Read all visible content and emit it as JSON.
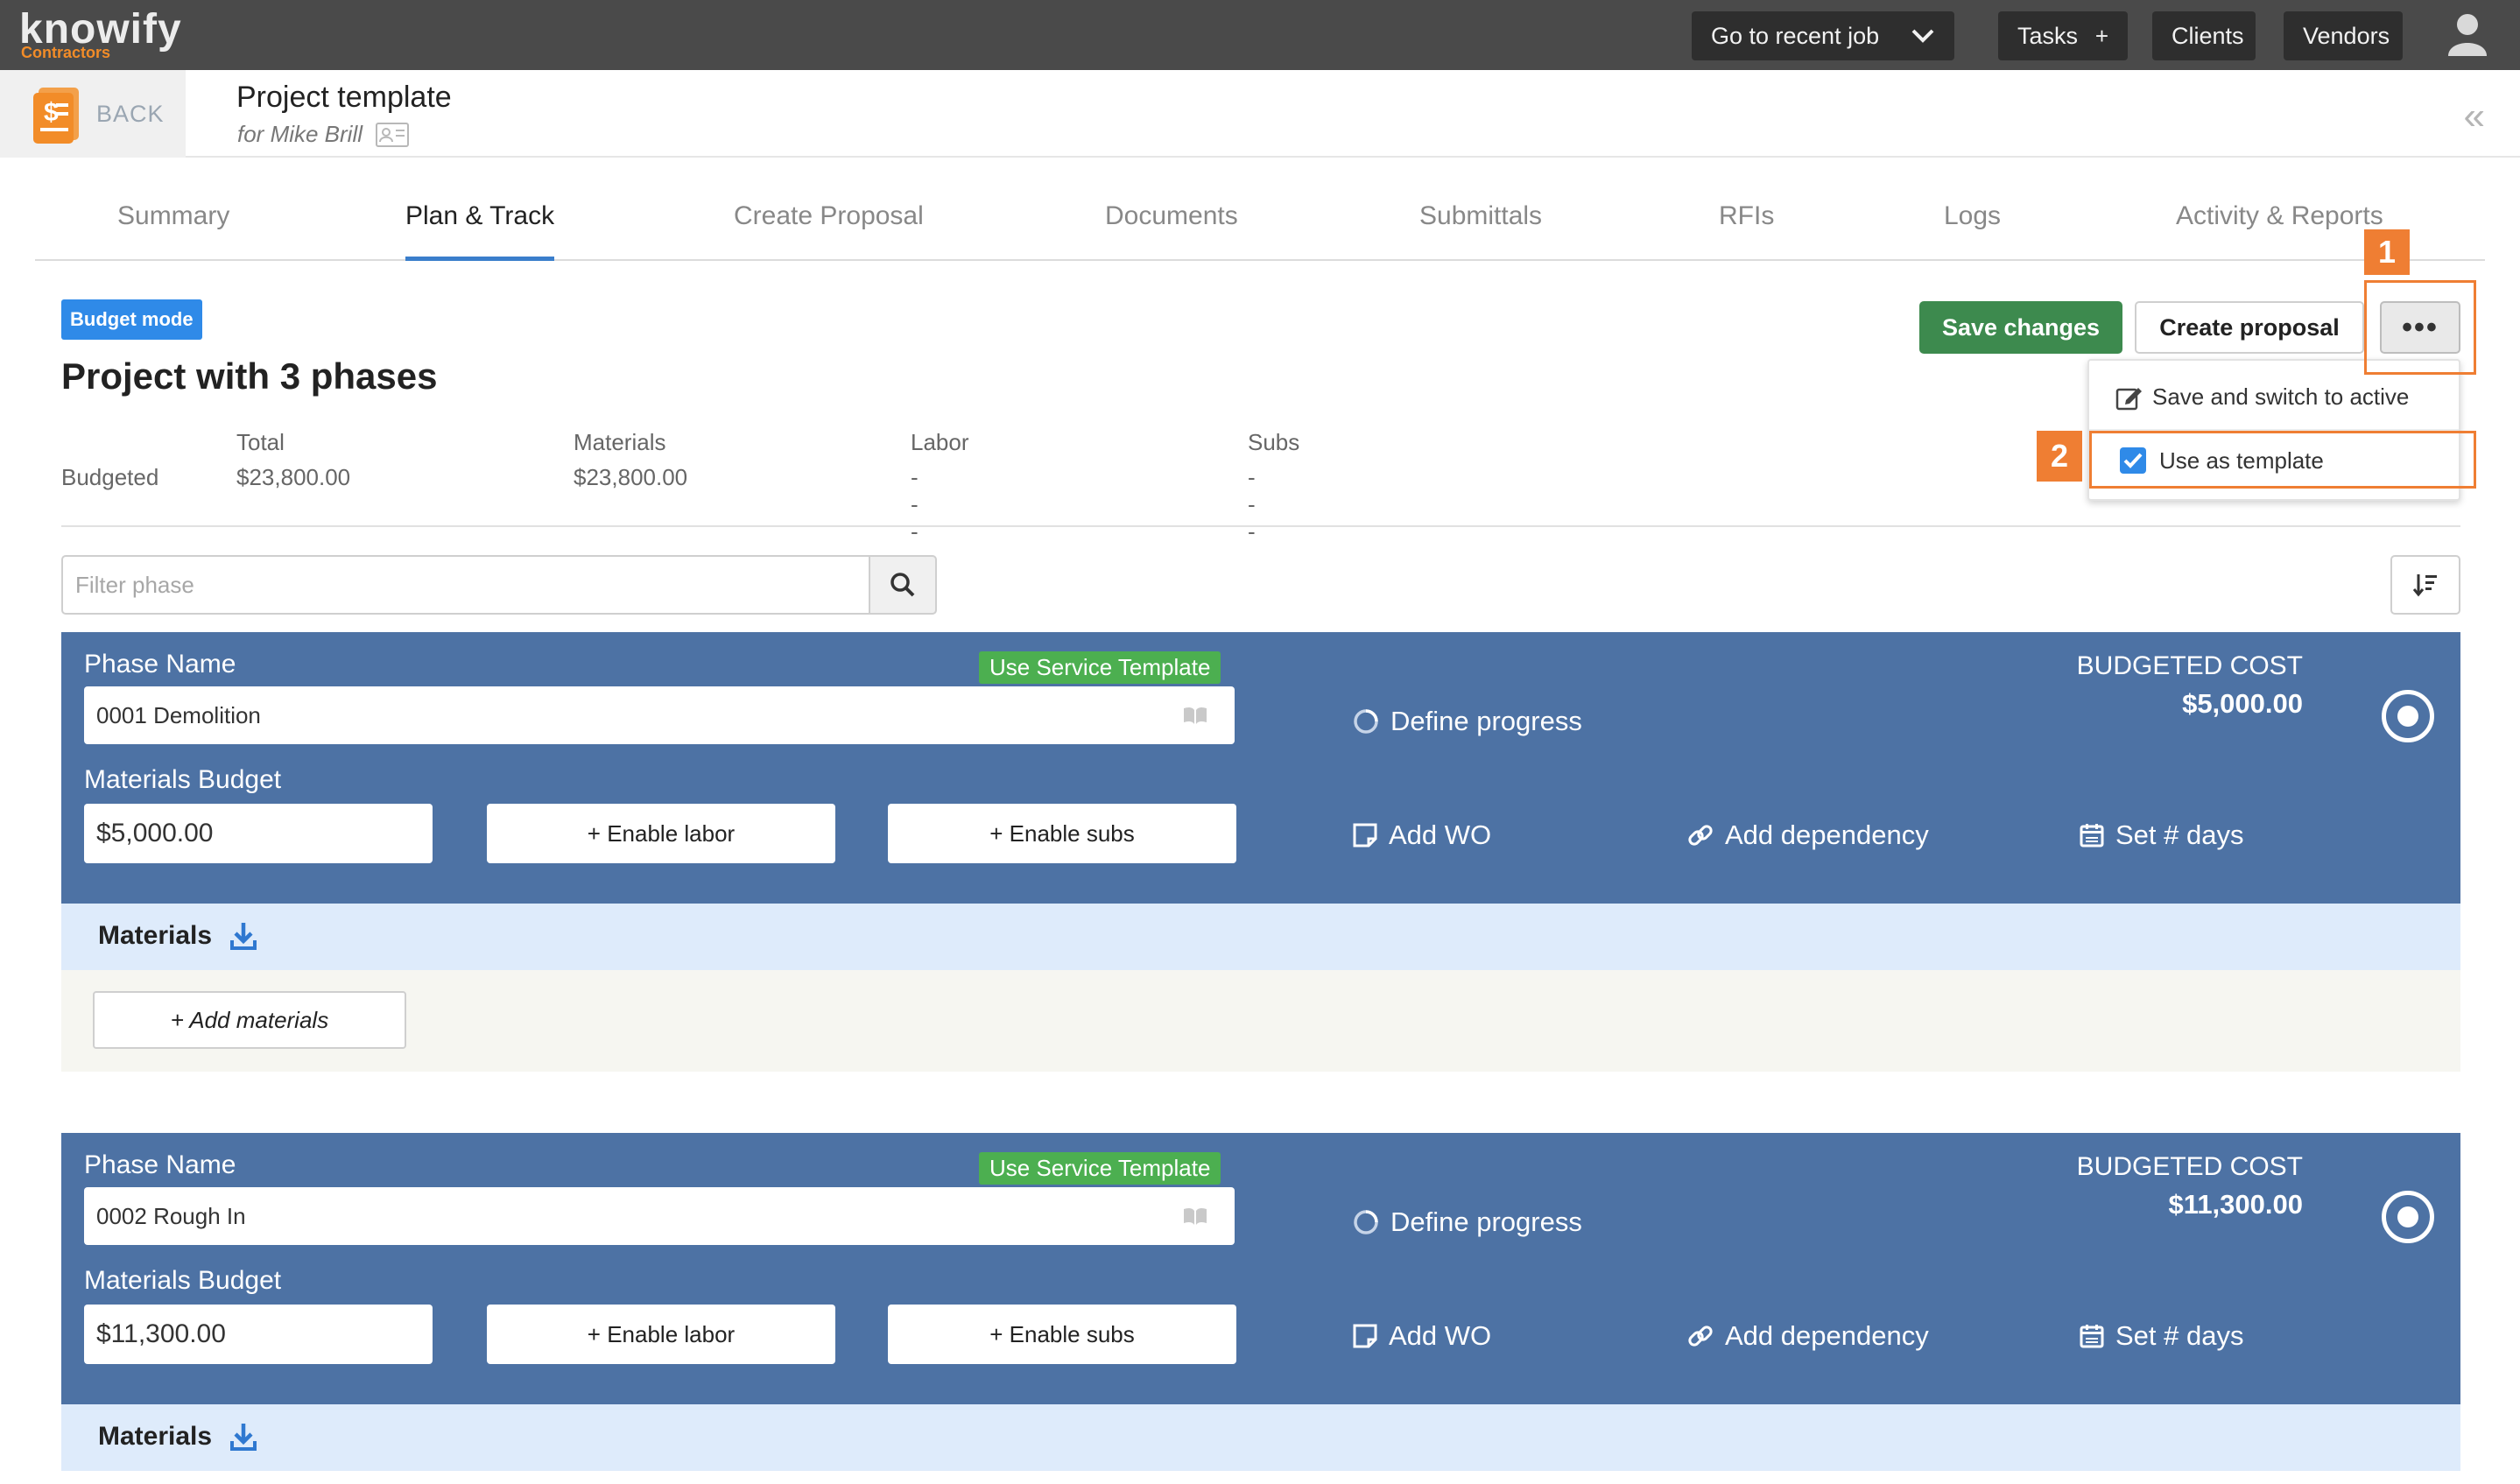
{
  "topbar": {
    "logo": "knowify",
    "logo_sub": "Contractors",
    "recent_job": "Go to recent job",
    "tasks": "Tasks",
    "tasks_plus": "+",
    "clients": "Clients",
    "vendors": "Vendors"
  },
  "header": {
    "back": "BACK",
    "title": "Project template",
    "subtitle": "for Mike Brill"
  },
  "tabs": [
    "Summary",
    "Plan & Track",
    "Create Proposal",
    "Documents",
    "Submittals",
    "RFIs",
    "Logs",
    "Activity & Reports"
  ],
  "active_tab": "Plan & Track",
  "badge": "Budget mode",
  "page_title": "Project with 3 phases",
  "actions": {
    "save": "Save changes",
    "create_proposal": "Create proposal",
    "more": "•••"
  },
  "dropdown": {
    "item1": "Save and switch to active",
    "item2": "Use as template",
    "item2_checked": true
  },
  "annotations": {
    "one": "1",
    "two": "2",
    "color": "#ef7e33"
  },
  "stats": {
    "row_label": "Budgeted",
    "total_h": "Total",
    "total_v": "$23,800.00",
    "materials_h": "Materials",
    "materials_v": "$23,800.00",
    "labor_h": "Labor",
    "labor_v": "---",
    "subs_h": "Subs",
    "subs_v": "---"
  },
  "filter": {
    "placeholder": "Filter phase"
  },
  "phases": [
    {
      "name_label": "Phase Name",
      "name": "0001 Demolition",
      "service_template": "Use Service Template",
      "budget_label": "Materials Budget",
      "budget": "$5,000.00",
      "enable_labor": "+ Enable labor",
      "enable_subs": "+ Enable subs",
      "define_progress": "Define progress",
      "add_wo": "Add WO",
      "add_dependency": "Add dependency",
      "set_days": "Set # days",
      "cost_label": "BUDGETED COST",
      "cost": "$5,000.00",
      "materials": "Materials",
      "add_materials": "+ Add materials"
    },
    {
      "name_label": "Phase Name",
      "name": "0002 Rough In",
      "service_template": "Use Service Template",
      "budget_label": "Materials Budget",
      "budget": "$11,300.00",
      "enable_labor": "+ Enable labor",
      "enable_subs": "+ Enable subs",
      "define_progress": "Define progress",
      "add_wo": "Add WO",
      "add_dependency": "Add dependency",
      "set_days": "Set # days",
      "cost_label": "BUDGETED COST",
      "cost": "$11,300.00",
      "materials": "Materials"
    }
  ],
  "colors": {
    "phase_bg": "#4d72a4",
    "accent": "#3a7ecb",
    "green": "#3d8a4e",
    "badge": "#2f8ae8"
  }
}
